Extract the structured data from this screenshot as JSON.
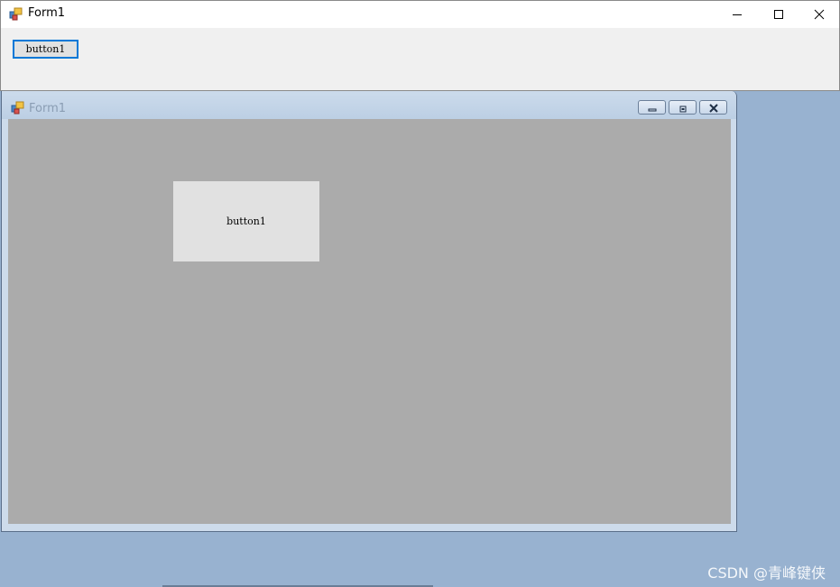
{
  "outer_window": {
    "title": "Form1",
    "icon": "winforms-app-icon",
    "controls": {
      "minimize": "minimize-icon",
      "maximize": "maximize-icon",
      "close": "close-icon"
    },
    "button_label": "button1"
  },
  "mdi_child": {
    "title": "Form1",
    "icon": "winforms-app-icon",
    "controls": {
      "minimize": "minimize-icon",
      "restore": "restore-icon",
      "close": "close-icon"
    },
    "button_label": "button1"
  },
  "watermark": "CSDN @青峰键侠",
  "colors": {
    "desktop": "#98b2d0",
    "outer_client": "#f0f0f0",
    "mdi_client": "#ababab",
    "button_face": "#e1e1e1",
    "focus_border": "#0078d7"
  }
}
